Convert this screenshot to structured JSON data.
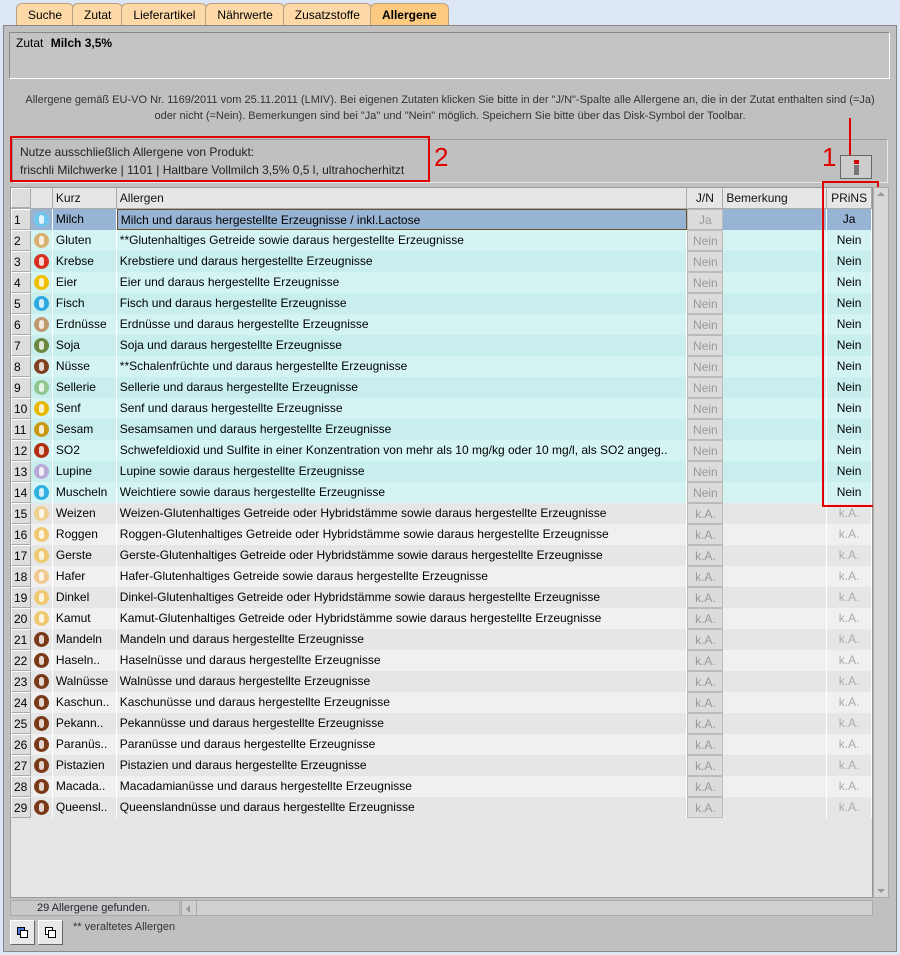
{
  "tabs": [
    {
      "label": "Suche"
    },
    {
      "label": "Zutat"
    },
    {
      "label": "Lieferartikel"
    },
    {
      "label": "Nährwerte"
    },
    {
      "label": "Zusatzstoffe"
    },
    {
      "label": "Allergene",
      "active": true
    }
  ],
  "zutat": {
    "label": "Zutat",
    "value": "Milch 3,5%"
  },
  "info_text": "Allergene gemäß EU-VO Nr. 1169/2011 vom 25.11.2011 (LMIV). Bei eigenen Zutaten klicken Sie bitte in der \"J/N\"-Spalte alle Allergene an, die in der Zutat enthalten sind (=Ja) oder nicht (=Nein). Bemerkungen sind bei \"Ja\" und \"Nein\" möglich. Speichern Sie bitte über das Disk-Symbol der Toolbar.",
  "product": {
    "label": "Nutze ausschließlich Allergene von Produkt:",
    "value": "frischli Milchwerke | 1101 | Haltbare Vollmilch 3,5% 0,5 l, ultrahocherhitzt"
  },
  "annotations": {
    "one": "1",
    "two": "2"
  },
  "info_button": "i",
  "columns": {
    "num": "",
    "icon": "",
    "kurz": "Kurz",
    "allergen": "Allergen",
    "jn": "J/N",
    "bemerkung": "Bemerkung",
    "prins": "PRiNS"
  },
  "rows": [
    {
      "n": "1",
      "color": "#6ec8ee",
      "kurz": "Milch",
      "allergen": "Milch und daraus hergestellte Erzeugnisse / inkl.Lactose",
      "jn": "Ja",
      "bem": "",
      "prins": "Ja"
    },
    {
      "n": "2",
      "color": "#d8b070",
      "kurz": "Gluten",
      "allergen": "**Glutenhaltiges Getreide sowie daraus hergestellte Erzeugnisse",
      "jn": "Nein",
      "bem": "",
      "prins": "Nein"
    },
    {
      "n": "3",
      "color": "#d83020",
      "kurz": "Krebse",
      "allergen": "Krebstiere und daraus hergestellte Erzeugnisse",
      "jn": "Nein",
      "bem": "",
      "prins": "Nein"
    },
    {
      "n": "4",
      "color": "#f0c000",
      "kurz": "Eier",
      "allergen": "Eier und daraus hergestellte Erzeugnisse",
      "jn": "Nein",
      "bem": "",
      "prins": "Nein"
    },
    {
      "n": "5",
      "color": "#30a8e0",
      "kurz": "Fisch",
      "allergen": "Fisch und daraus hergestellte Erzeugnisse",
      "jn": "Nein",
      "bem": "",
      "prins": "Nein"
    },
    {
      "n": "6",
      "color": "#c09870",
      "kurz": "Erdnüsse",
      "allergen": "Erdnüsse und daraus hergestellte Erzeugnisse",
      "jn": "Nein",
      "bem": "",
      "prins": "Nein"
    },
    {
      "n": "7",
      "color": "#6a8840",
      "kurz": "Soja",
      "allergen": "Soja und daraus hergestellte Erzeugnisse",
      "jn": "Nein",
      "bem": "",
      "prins": "Nein"
    },
    {
      "n": "8",
      "color": "#804020",
      "kurz": "Nüsse",
      "allergen": "**Schalenfrüchte und daraus hergestellte Erzeugnisse",
      "jn": "Nein",
      "bem": "",
      "prins": "Nein"
    },
    {
      "n": "9",
      "color": "#90c890",
      "kurz": "Sellerie",
      "allergen": "Sellerie und daraus hergestellte Erzeugnisse",
      "jn": "Nein",
      "bem": "",
      "prins": "Nein"
    },
    {
      "n": "10",
      "color": "#e8b800",
      "kurz": "Senf",
      "allergen": "Senf und daraus hergestellte Erzeugnisse",
      "jn": "Nein",
      "bem": "",
      "prins": "Nein"
    },
    {
      "n": "11",
      "color": "#c89810",
      "kurz": "Sesam",
      "allergen": "Sesamsamen und daraus hergestellte Erzeugnisse",
      "jn": "Nein",
      "bem": "",
      "prins": "Nein"
    },
    {
      "n": "12",
      "color": "#b03010",
      "kurz": "SO2",
      "allergen": "Schwefeldioxid und Sulfite in einer Konzentration von mehr als 10 mg/kg oder 10 mg/l, als SO2 angeg..",
      "jn": "Nein",
      "bem": "",
      "prins": "Nein"
    },
    {
      "n": "13",
      "color": "#b8a8d8",
      "kurz": "Lupine",
      "allergen": "Lupine sowie daraus hergestellte Erzeugnisse",
      "jn": "Nein",
      "bem": "",
      "prins": "Nein"
    },
    {
      "n": "14",
      "color": "#30b0e0",
      "kurz": "Muscheln",
      "allergen": "Weichtiere sowie daraus hergestellte Erzeugnisse",
      "jn": "Nein",
      "bem": "",
      "prins": "Nein"
    },
    {
      "n": "15",
      "color": "#f0d090",
      "kurz": "Weizen",
      "allergen": "Weizen-Glutenhaltiges Getreide oder Hybridstämme sowie daraus hergestellte Erzeugnisse",
      "jn": "k.A.",
      "bem": "",
      "prins": "k.A."
    },
    {
      "n": "16",
      "color": "#f0c870",
      "kurz": "Roggen",
      "allergen": "Roggen-Glutenhaltiges Getreide oder Hybridstämme sowie daraus hergestellte Erzeugnisse",
      "jn": "k.A.",
      "bem": "",
      "prins": "k.A."
    },
    {
      "n": "17",
      "color": "#f0c870",
      "kurz": "Gerste",
      "allergen": "Gerste-Glutenhaltiges Getreide oder Hybridstämme sowie daraus hergestellte Erzeugnisse",
      "jn": "k.A.",
      "bem": "",
      "prins": "k.A."
    },
    {
      "n": "18",
      "color": "#f0c890",
      "kurz": "Hafer",
      "allergen": "Hafer-Glutenhaltiges Getreide sowie daraus hergestellte Erzeugnisse",
      "jn": "k.A.",
      "bem": "",
      "prins": "k.A."
    },
    {
      "n": "19",
      "color": "#f0c870",
      "kurz": "Dinkel",
      "allergen": "Dinkel-Glutenhaltiges Getreide oder Hybridstämme sowie daraus hergestellte Erzeugnisse",
      "jn": "k.A.",
      "bem": "",
      "prins": "k.A."
    },
    {
      "n": "20",
      "color": "#f0c870",
      "kurz": "Kamut",
      "allergen": "Kamut-Glutenhaltiges Getreide oder Hybridstämme sowie daraus hergestellte Erzeugnisse",
      "jn": "k.A.",
      "bem": "",
      "prins": "k.A."
    },
    {
      "n": "21",
      "color": "#7a3a18",
      "kurz": "Mandeln",
      "allergen": "Mandeln und daraus hergestellte Erzeugnisse",
      "jn": "k.A.",
      "bem": "",
      "prins": "k.A."
    },
    {
      "n": "22",
      "color": "#7a3a18",
      "kurz": "Haseln..",
      "allergen": "Haselnüsse und daraus hergestellte Erzeugnisse",
      "jn": "k.A.",
      "bem": "",
      "prins": "k.A."
    },
    {
      "n": "23",
      "color": "#7a3a18",
      "kurz": "Walnüsse",
      "allergen": "Walnüsse und daraus hergestellte Erzeugnisse",
      "jn": "k.A.",
      "bem": "",
      "prins": "k.A."
    },
    {
      "n": "24",
      "color": "#7a3a18",
      "kurz": "Kaschun..",
      "allergen": "Kaschunüsse und daraus hergestellte Erzeugnisse",
      "jn": "k.A.",
      "bem": "",
      "prins": "k.A."
    },
    {
      "n": "25",
      "color": "#7a3a18",
      "kurz": "Pekann..",
      "allergen": "Pekannüsse und daraus hergestellte Erzeugnisse",
      "jn": "k.A.",
      "bem": "",
      "prins": "k.A."
    },
    {
      "n": "26",
      "color": "#7a3a18",
      "kurz": "Paranüs..",
      "allergen": "Paranüsse und daraus hergestellte Erzeugnisse",
      "jn": "k.A.",
      "bem": "",
      "prins": "k.A."
    },
    {
      "n": "27",
      "color": "#7a3a18",
      "kurz": "Pistazien",
      "allergen": "Pistazien und daraus hergestellte Erzeugnisse",
      "jn": "k.A.",
      "bem": "",
      "prins": "k.A."
    },
    {
      "n": "28",
      "color": "#7a3a18",
      "kurz": "Macada..",
      "allergen": "Macadamianüsse und daraus hergestellte Erzeugnisse",
      "jn": "k.A.",
      "bem": "",
      "prins": "k.A."
    },
    {
      "n": "29",
      "color": "#7a3a18",
      "kurz": "Queensl..",
      "allergen": "Queenslandnüsse und daraus hergestellte Erzeugnisse",
      "jn": "k.A.",
      "bem": "",
      "prins": "k.A."
    }
  ],
  "status": "29  Allergene gefunden.",
  "note": "** veraltetes Allergen"
}
